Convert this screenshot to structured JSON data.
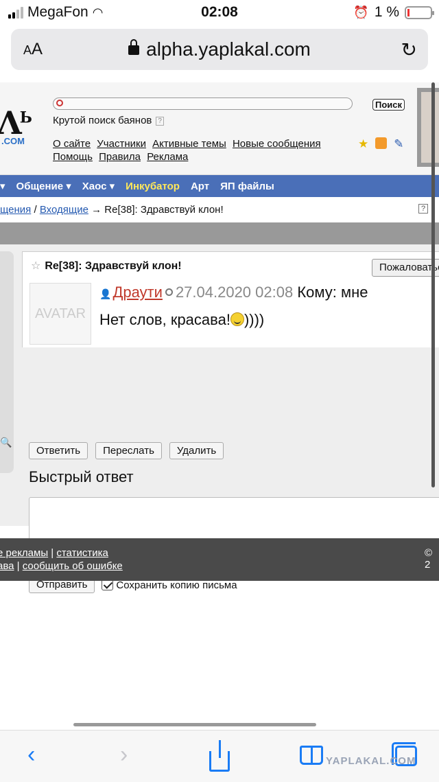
{
  "status_bar": {
    "carrier": "MegaFon",
    "time": "02:08",
    "battery": "1 %"
  },
  "address_bar": {
    "text_size_label": "AA",
    "url": "alpha.yaplakal.com"
  },
  "header": {
    "logo_text": "Λ",
    "logo_sup": "Ь",
    "logo_domain": ".COM",
    "search_button": "Поиск",
    "search_caption": "Крутой поиск баянов",
    "search_help": "?",
    "links": [
      "О сайте",
      "Участники",
      "Активные темы",
      "Новые сообщения",
      "Помощь",
      "Правила",
      "Реклама"
    ]
  },
  "nav": {
    "items": [
      "",
      "Общение ▾",
      "Хаос ▾",
      "Инкубатор",
      "Арт",
      "ЯП файлы"
    ]
  },
  "breadcrumb": {
    "part1": "щения",
    "separator1": " / ",
    "part2": "Входящие",
    "arrow": " → ",
    "current": "Re[38]: Здравствуй клон!",
    "help": "?"
  },
  "message": {
    "title": "Re[38]: Здравствуй клон!",
    "report_button": "Пожаловаться",
    "avatar_text": "AVATAR",
    "author": "Драути",
    "date": "27.04.2020 02:08",
    "recipient": "Кому: мне",
    "body_before": "Нет слов, красава!",
    "body_after": "))))"
  },
  "actions": {
    "reply": "Ответить",
    "forward": "Переслать",
    "delete": "Удалить"
  },
  "quick_reply": {
    "title": "Быстрый ответ",
    "text": "",
    "send_button": "Отправить",
    "save_copy_label": "Сохранить копию письма",
    "save_copy_checked": true
  },
  "footer": {
    "l1_a": "е рекламы",
    "sep": " | ",
    "l1_b": "статистика",
    "l2_a": "ава",
    "l2_b": "сообщить об ошибке",
    "copyright": "© 2"
  },
  "watermark": "YAPLAKAL.COM",
  "colors": {
    "nav_bg": "#4a6fb8",
    "nav_highlight": "#ffe85a",
    "author": "#c0392b",
    "safari_blue": "#1a7cf5"
  },
  "icons": [
    "wifi-icon",
    "alarm-icon",
    "lock-icon",
    "reload-icon",
    "star-icon",
    "rss-icon",
    "pencil-icon",
    "user-icon",
    "clock-icon",
    "smiley-icon",
    "back-icon",
    "forward-icon",
    "share-icon",
    "bookmarks-icon",
    "tabs-icon"
  ]
}
